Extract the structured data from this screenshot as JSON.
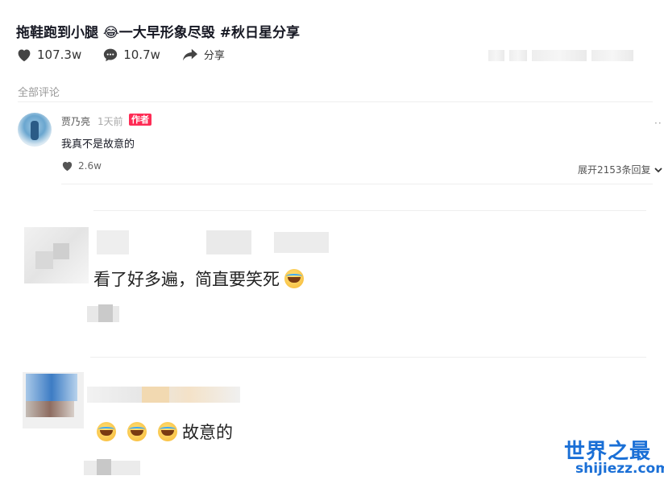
{
  "post": {
    "title": "拖鞋跑到小腿 😂一大早形象尽毁 #秋日星分享",
    "likes": "107.3w",
    "comments": "10.7w",
    "share_label": "分享"
  },
  "comments_section": {
    "header": "全部评论",
    "first": {
      "username": "贾乃亮",
      "time": "1天前",
      "badge": "作者",
      "text": "我真不是故意的",
      "likes": "2.6w",
      "expand_label": "展开2153条回复"
    },
    "second": {
      "text": "看了好多遍，简直要笑死"
    },
    "third": {
      "text": "故意的"
    }
  },
  "watermark": {
    "title": "世界之最",
    "url": "shijiezz.com"
  }
}
